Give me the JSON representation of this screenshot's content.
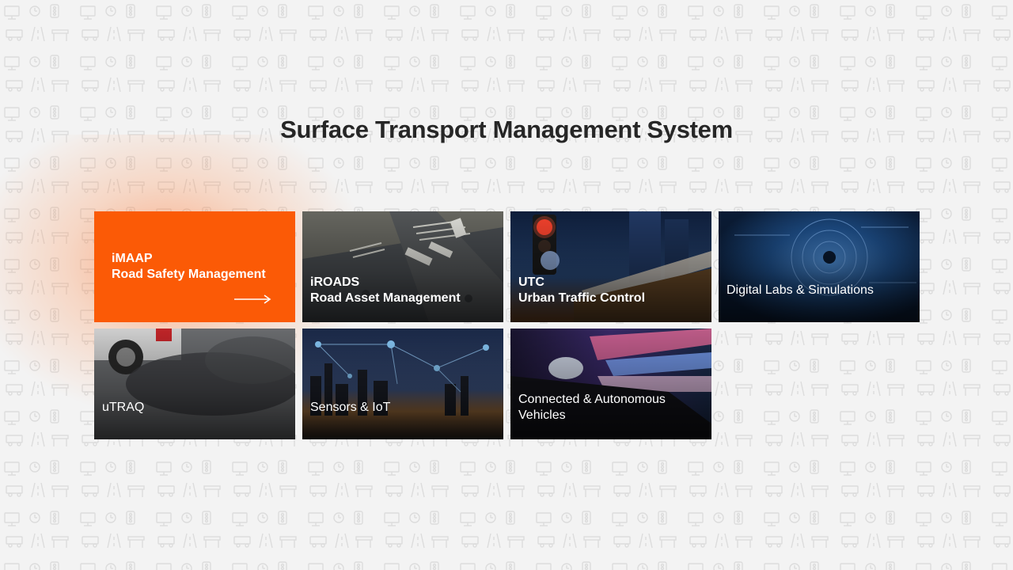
{
  "header": {
    "title": "Surface Transport Management System"
  },
  "tiles": [
    {
      "line1": "iMAAP",
      "line2": "Road Safety Management",
      "style": "orange-active"
    },
    {
      "line1": "iROADS",
      "line2": "Road Asset Management"
    },
    {
      "line1": "UTC",
      "line2": "Urban Traffic Control"
    },
    {
      "line1": "Digital Labs & Simulations"
    },
    {
      "line1": "uTRAQ"
    },
    {
      "line1": "Sensors & IoT"
    },
    {
      "line1": "Connected & Autonomous",
      "line2": "Vehicles"
    }
  ],
  "icons": {
    "tile_1_arrow": "arrow-right-icon",
    "background": "transport-icon-pattern"
  },
  "colors": {
    "accent": "#fb5a06",
    "title": "#262626",
    "background": "#f3f3f3",
    "pattern": "#e2e2e2"
  }
}
